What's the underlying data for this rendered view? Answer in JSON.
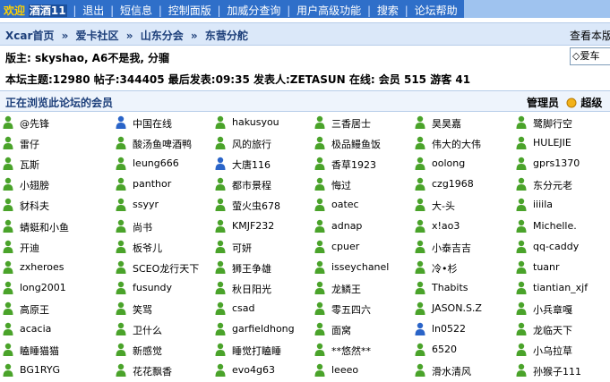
{
  "topbar": {
    "welcome": "欢迎",
    "username": "酒酒11",
    "links": [
      "退出",
      "短信息",
      "控制面版",
      "加威分查询",
      "用户高级功能",
      "搜索",
      "论坛帮助"
    ]
  },
  "breadcrumb": [
    "Xcar首页",
    "爱卡社区",
    "山东分会",
    "东营分舵"
  ],
  "nav_right": "查看本版",
  "moderators": "版主: skyshao, A6不是我, 分骝",
  "jump_select": "◇爱车",
  "stats": "本坛主题:12980 帖子:344405 最后发表:09:35 发表人:ZETASUN 在线: 会员 515 游客 41",
  "online_title": "正在浏览此论坛的会员",
  "legend": {
    "admin_label": "管理员",
    "super_label": "超级"
  },
  "colors": {
    "topbar": "#2f6fc9",
    "navbar": "#dbe8f9",
    "green_icon": "#4aa32a",
    "blue_icon": "#2a64c8"
  },
  "members": [
    [
      "@先锋",
      "中国在线",
      "hakusyou",
      "三香居士",
      "昊昊嘉",
      "鹭脚行空"
    ],
    [
      "雷仔",
      "酸汤鱼啤酒鸭",
      "风的旅行",
      "极品鳗鱼饭",
      "伟大的大伟",
      "HULEJIE"
    ],
    [
      "瓦斯",
      "leung666",
      "大唐116",
      "香草1923",
      "oolong",
      "gprs1370"
    ],
    [
      "小翅膀",
      "panthor",
      "都市景程",
      "悔过",
      "czg1968",
      "东分元老"
    ],
    [
      "豺科夫",
      "ssyyr",
      "萤火虫678",
      "oatec",
      "大-头",
      "iiiila"
    ],
    [
      "蜻蜓和小鱼",
      "尚书",
      "KMJF232",
      "adnap",
      "x!ao3",
      "Michelle."
    ],
    [
      "开迪",
      "板爷儿",
      "可妍",
      "cpuer",
      "小泰吉吉",
      "qq-caddy"
    ],
    [
      "zxheroes",
      "SCEO龙行天下",
      "狮王争雄",
      "isseychanel",
      "冷•杉",
      "tuanr"
    ],
    [
      "long2001",
      "fusundy",
      "秋日阳光",
      "龙鳞王",
      "Thabits",
      "tiantian_xjf"
    ],
    [
      "高原王",
      "笑骂",
      "csad",
      "零五四六",
      "JASON.S.Z",
      "小兵章嘎"
    ],
    [
      "acacia",
      "卫什么",
      "garfieldhong",
      "面窝",
      "ln0522",
      "龙临天下"
    ],
    [
      "瞌睡猫猫",
      "新感觉",
      "睡觉打瞌睡",
      "**悠然**",
      "6520",
      "小乌拉草"
    ],
    [
      "BG1RYG",
      "花花飘香",
      "evo4g63",
      "leeeo",
      "滑水清风",
      "孙猴子111"
    ]
  ],
  "blue_members": [
    "中国在线",
    "大唐116",
    "ln0522"
  ]
}
